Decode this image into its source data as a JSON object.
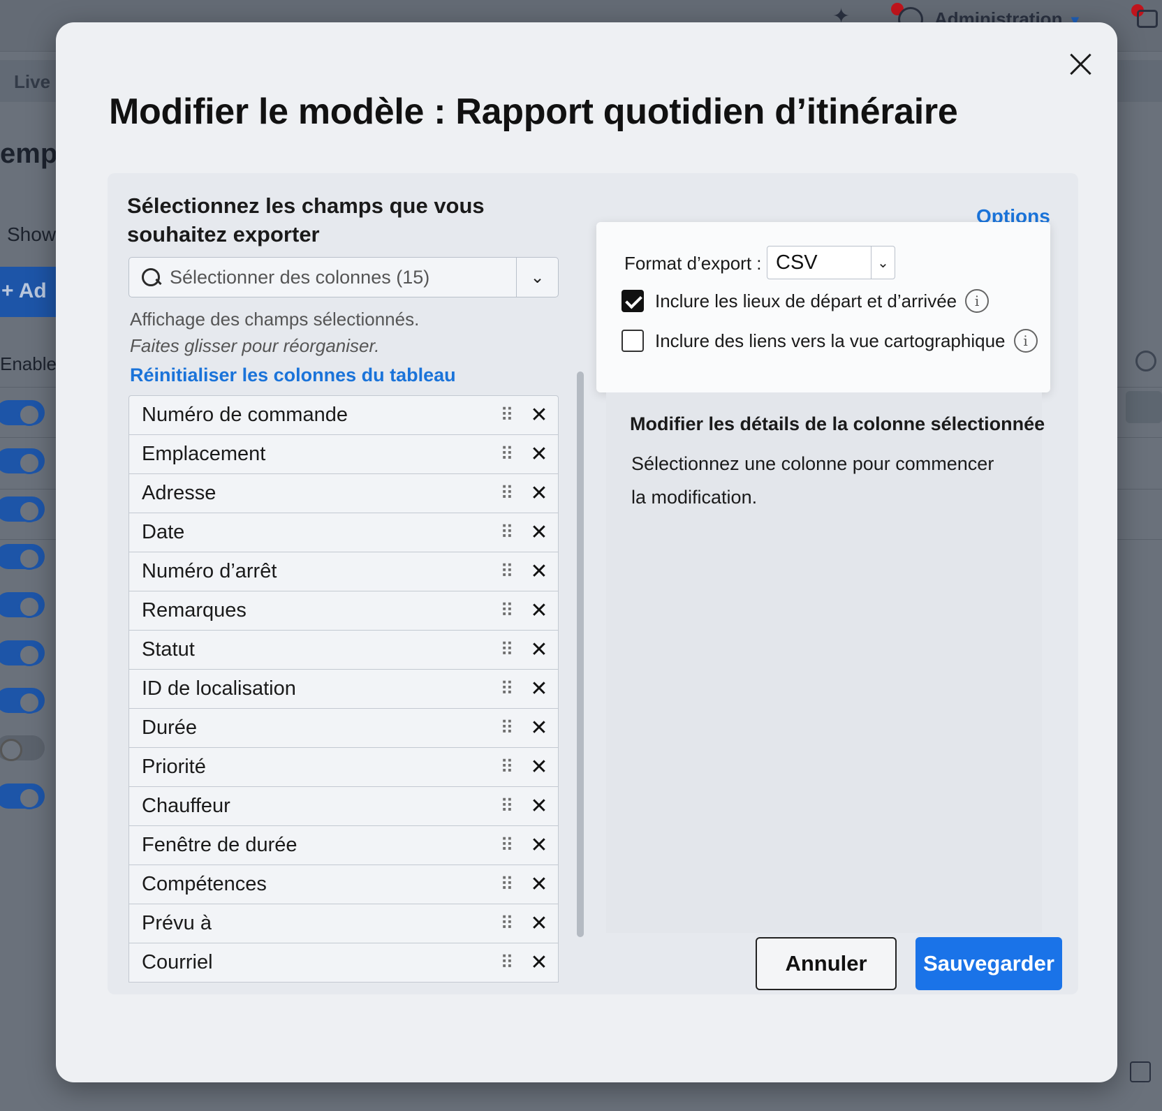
{
  "background": {
    "header_admin": "Administration",
    "tab_live": "Live",
    "page_title_partial": "empla",
    "show_label_partial": "Show",
    "add_button_partial": "+ Ad",
    "enabled_label_partial": "Enable",
    "toggles": [
      true,
      true,
      true,
      true,
      true,
      true,
      true,
      false,
      true
    ]
  },
  "modal": {
    "title": "Modifier le modèle : Rapport quotidien d’itinéraire",
    "left": {
      "heading": "Sélectionnez les champs que vous souhaitez exporter",
      "column_select_placeholder": "Sélectionner des colonnes (15)",
      "hint_display": "Affichage des champs sélectionnés.",
      "hint_drag": "Faites glisser pour réorganiser.",
      "reset_link": "Réinitialiser les colonnes du tableau",
      "fields": [
        "Numéro de commande",
        "Emplacement",
        "Adresse",
        "Date",
        "Numéro d’arrêt",
        "Remarques",
        "Statut",
        "ID de localisation",
        "Durée",
        "Priorité",
        "Chauffeur",
        "Fenêtre de durée",
        "Compétences",
        "Prévu à",
        "Courriel"
      ]
    },
    "options": {
      "link": "Options",
      "format_label": "Format d’export :",
      "format_value": "CSV",
      "include_start_end_label": "Inclure les lieux de départ et d’arrivée",
      "include_start_end_checked": true,
      "include_map_links_label": "Inclure des liens vers la vue cartographique",
      "include_map_links_checked": false
    },
    "details": {
      "title": "Modifier les détails de la colonne sélectionnée",
      "body": "Sélectionnez une colonne pour commencer la modification."
    },
    "footer": {
      "cancel": "Annuler",
      "save": "Sauvegarder"
    }
  },
  "colors": {
    "accent": "#1a73e8",
    "link": "#1a73d9"
  }
}
